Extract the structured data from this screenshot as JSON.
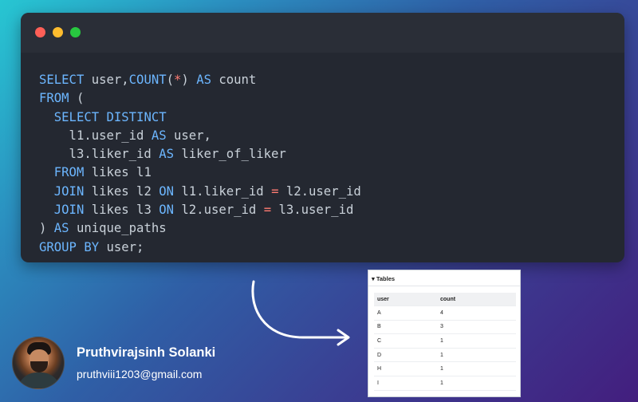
{
  "window": {
    "traffic_lights": {
      "close_color": "#ff5f57",
      "minimize_color": "#febc2e",
      "maximize_color": "#28c840"
    }
  },
  "code_lines": [
    [
      {
        "t": "SELECT ",
        "c": "kw"
      },
      {
        "t": "user,",
        "c": "plain"
      },
      {
        "t": "COUNT",
        "c": "kw"
      },
      {
        "t": "(",
        "c": "plain"
      },
      {
        "t": "*",
        "c": "op"
      },
      {
        "t": ") ",
        "c": "plain"
      },
      {
        "t": "AS",
        "c": "kw"
      },
      {
        "t": " count",
        "c": "plain"
      }
    ],
    [
      {
        "t": "FROM",
        "c": "kw"
      },
      {
        "t": " (",
        "c": "plain"
      }
    ],
    [
      {
        "t": "  ",
        "c": "plain"
      },
      {
        "t": "SELECT DISTINCT",
        "c": "kw"
      }
    ],
    [
      {
        "t": "    l1.user_id ",
        "c": "plain"
      },
      {
        "t": "AS",
        "c": "kw"
      },
      {
        "t": " user,",
        "c": "plain"
      }
    ],
    [
      {
        "t": "    l3.liker_id ",
        "c": "plain"
      },
      {
        "t": "AS",
        "c": "kw"
      },
      {
        "t": " liker_of_liker",
        "c": "plain"
      }
    ],
    [
      {
        "t": "  ",
        "c": "plain"
      },
      {
        "t": "FROM",
        "c": "kw"
      },
      {
        "t": " likes l1",
        "c": "plain"
      }
    ],
    [
      {
        "t": "  ",
        "c": "plain"
      },
      {
        "t": "JOIN",
        "c": "kw"
      },
      {
        "t": " likes l2 ",
        "c": "plain"
      },
      {
        "t": "ON",
        "c": "kw"
      },
      {
        "t": " l1.liker_id ",
        "c": "plain"
      },
      {
        "t": "=",
        "c": "op"
      },
      {
        "t": " l2.user_id",
        "c": "plain"
      }
    ],
    [
      {
        "t": "  ",
        "c": "plain"
      },
      {
        "t": "JOIN",
        "c": "kw"
      },
      {
        "t": " likes l3 ",
        "c": "plain"
      },
      {
        "t": "ON",
        "c": "kw"
      },
      {
        "t": " l2.user_id ",
        "c": "plain"
      },
      {
        "t": "=",
        "c": "op"
      },
      {
        "t": " l3.user_id",
        "c": "plain"
      }
    ],
    [
      {
        "t": ") ",
        "c": "plain"
      },
      {
        "t": "AS",
        "c": "kw"
      },
      {
        "t": " unique_paths",
        "c": "plain"
      }
    ],
    [
      {
        "t": "GROUP BY",
        "c": "kw"
      },
      {
        "t": " user;",
        "c": "plain"
      }
    ]
  ],
  "results": {
    "section_label": "▾ Tables",
    "columns": [
      "user",
      "count"
    ],
    "rows": [
      [
        "A",
        "4"
      ],
      [
        "B",
        "3"
      ],
      [
        "C",
        "1"
      ],
      [
        "D",
        "1"
      ],
      [
        "H",
        "1"
      ],
      [
        "I",
        "1"
      ]
    ]
  },
  "author": {
    "name": "Pruthvirajsinh Solanki",
    "email": "pruthviii1203@gmail.com",
    "avatar_icon": "profile-photo"
  },
  "arrow_icon": "curved-arrow-right-icon"
}
